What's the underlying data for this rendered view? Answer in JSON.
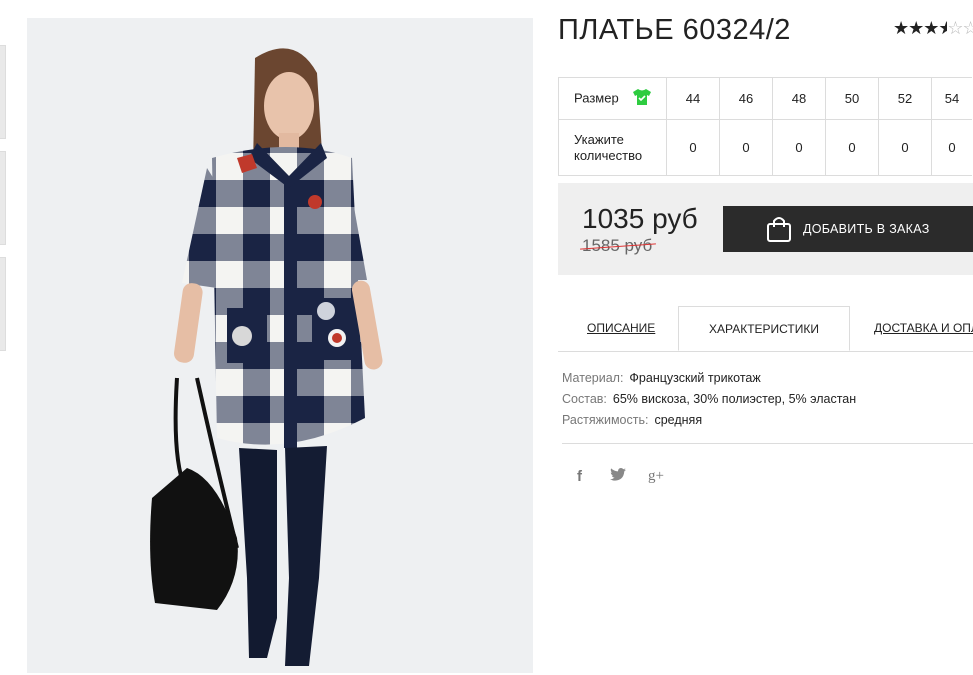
{
  "product": {
    "title": "ПЛАТЬЕ 60324/2",
    "rating_stars_filled": "★★★",
    "rating_stars_half": "★",
    "rating_stars_empty": "☆☆",
    "rating_value": 3.5
  },
  "size_table": {
    "size_label": "Размер",
    "qty_label_line1": "Укажите",
    "qty_label_line2": "количество",
    "sizes": [
      "44",
      "46",
      "48",
      "50",
      "52",
      "54"
    ],
    "quantities": [
      "0",
      "0",
      "0",
      "0",
      "0",
      "0"
    ]
  },
  "price": {
    "current": "1035 руб",
    "old": "1585 руб"
  },
  "actions": {
    "add_to_order": "ДОБАВИТЬ В ЗАКАЗ"
  },
  "tabs": {
    "description": "ОПИСАНИЕ",
    "characteristics": "ХАРАКТЕРИСТИКИ",
    "delivery": "ДОСТАВКА И ОПЛ"
  },
  "characteristics": {
    "material_key": "Материал:",
    "material_value": "Французский трикотаж",
    "composition_key": "Состав:",
    "composition_value": "65% вискоза, 30% полиэстер, 5% эластан",
    "stretch_key": "Растяжимость:",
    "stretch_value": "средняя"
  },
  "social": {
    "facebook": "f",
    "twitter": "t",
    "googleplus": "g+"
  },
  "colors": {
    "accent_green": "#2ecc40",
    "button_dark": "#2b2b2b",
    "strike_red": "#dd3333"
  }
}
